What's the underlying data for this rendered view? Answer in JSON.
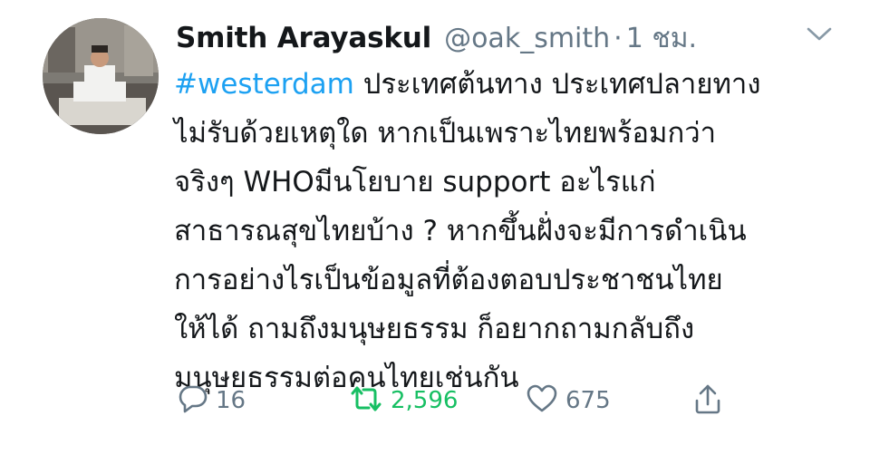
{
  "tweet": {
    "author_name": "Smith Arayaskul",
    "handle": "@oak_smith",
    "separator": "·",
    "time": "1 ชม.",
    "hashtag": "#westerdam",
    "text": " ประเทศต้นทาง ประเทศปลายทาง\nไม่รับด้วยเหตุใด หากเป็นเพราะไทยพร้อมกว่า\nจริงๆ WHOมีนโยบาย support อะไรแก่\nสาธารณสุขไทยบ้าง ?  หากขึ้นฝั่งจะมีการดำเนิน\nการอย่างไรเป็นข้อมูลที่ต้องตอบประชาชนไทย\nให้ได้ ถามถึงมนุษยธรรม ก็อยากถามกลับถึง\nมนุษยธรรมต่อคนไทยเช่นกัน"
  },
  "actions": {
    "reply": {
      "icon": "reply-icon",
      "count": "16"
    },
    "retweet": {
      "icon": "retweet-icon",
      "count": "2,596"
    },
    "like": {
      "icon": "heart-icon",
      "count": "675"
    },
    "share": {
      "icon": "share-icon"
    }
  },
  "colors": {
    "hashtag": "#1da1f2",
    "secondary_text": "#657786",
    "retweet_active": "#17bf63",
    "primary_text": "#14171a"
  }
}
